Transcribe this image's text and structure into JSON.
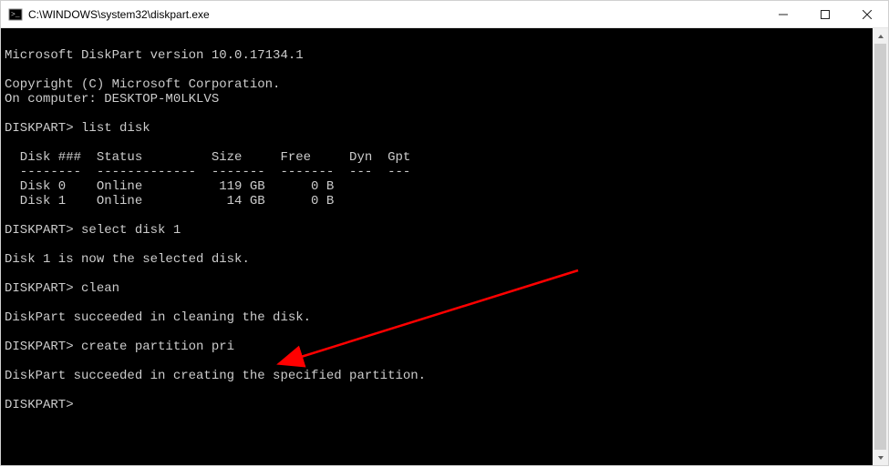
{
  "titlebar": {
    "title": "C:\\WINDOWS\\system32\\diskpart.exe"
  },
  "terminal": {
    "lines": [
      "",
      "Microsoft DiskPart version 10.0.17134.1",
      "",
      "Copyright (C) Microsoft Corporation.",
      "On computer: DESKTOP-M0LKLVS",
      "",
      "DISKPART> list disk",
      "",
      "  Disk ###  Status         Size     Free     Dyn  Gpt",
      "  --------  -------------  -------  -------  ---  ---",
      "  Disk 0    Online          119 GB      0 B",
      "  Disk 1    Online           14 GB      0 B",
      "",
      "DISKPART> select disk 1",
      "",
      "Disk 1 is now the selected disk.",
      "",
      "DISKPART> clean",
      "",
      "DiskPart succeeded in cleaning the disk.",
      "",
      "DISKPART> create partition pri",
      "",
      "DiskPart succeeded in creating the specified partition.",
      "",
      "DISKPART>"
    ]
  },
  "diskpart": {
    "version": "10.0.17134.1",
    "computer": "DESKTOP-M0LKLVS",
    "commands": [
      {
        "prompt": "DISKPART>",
        "command": "list disk"
      },
      {
        "prompt": "DISKPART>",
        "command": "select disk 1"
      },
      {
        "prompt": "DISKPART>",
        "command": "clean"
      },
      {
        "prompt": "DISKPART>",
        "command": "create partition pri"
      },
      {
        "prompt": "DISKPART>",
        "command": ""
      }
    ],
    "disks": [
      {
        "id": "Disk 0",
        "status": "Online",
        "size": "119 GB",
        "free": "0 B",
        "dyn": "",
        "gpt": ""
      },
      {
        "id": "Disk 1",
        "status": "Online",
        "size": "14 GB",
        "free": "0 B",
        "dyn": "",
        "gpt": ""
      }
    ],
    "messages": [
      "Disk 1 is now the selected disk.",
      "DiskPart succeeded in cleaning the disk.",
      "DiskPart succeeded in creating the specified partition."
    ]
  },
  "annotation": {
    "arrow_color": "#ff0000"
  }
}
